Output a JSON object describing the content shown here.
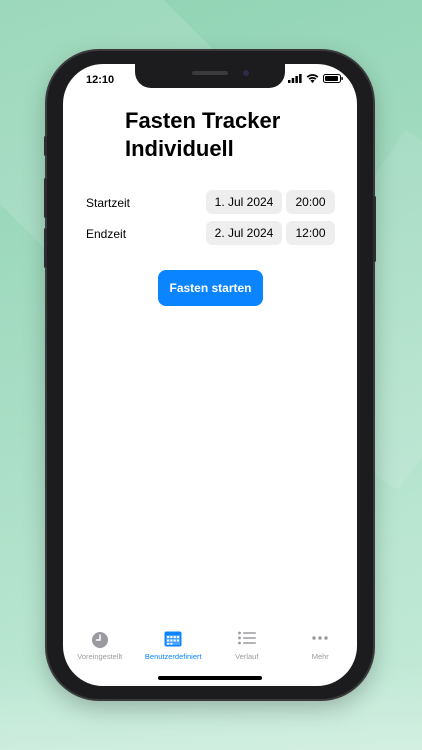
{
  "status_bar": {
    "time": "12:10"
  },
  "title_line1": "Fasten Tracker",
  "title_line2": "Individuell",
  "rows": [
    {
      "label": "Startzeit",
      "date": "1. Jul 2024",
      "time": "20:00"
    },
    {
      "label": "Endzeit",
      "date": "2. Jul 2024",
      "time": "12:00"
    }
  ],
  "start_button_label": "Fasten starten",
  "tabs": [
    {
      "label": "Voreingestellt",
      "icon": "clock-icon",
      "active": false
    },
    {
      "label": "Benutzerdefiniert",
      "icon": "calendar-icon",
      "active": true
    },
    {
      "label": "Verlauf",
      "icon": "list-icon",
      "active": false
    },
    {
      "label": "Mehr",
      "icon": "more-icon",
      "active": false
    }
  ],
  "colors": {
    "accent": "#0a84ff",
    "background": "#a7ddc4",
    "pill": "#eeeeef"
  }
}
